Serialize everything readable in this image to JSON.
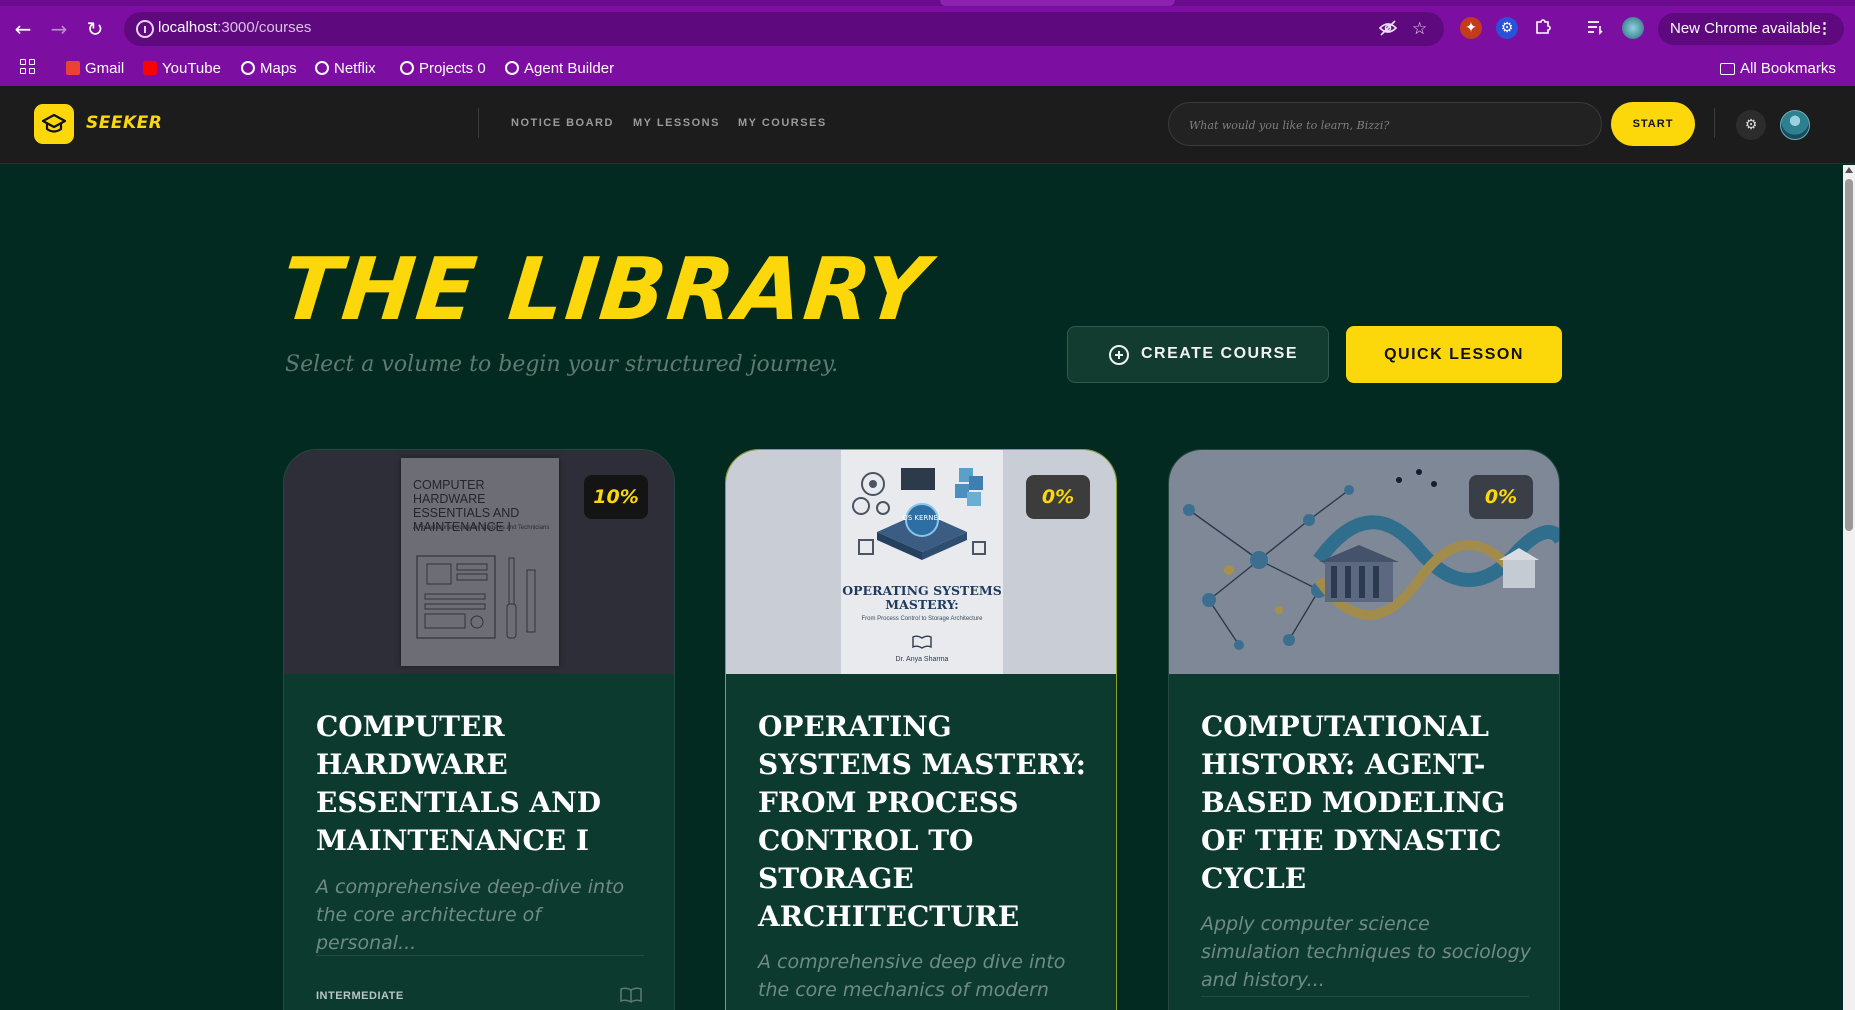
{
  "browser": {
    "url_host": "localhost",
    "url_path": ":3000/courses",
    "update_label": "New Chrome available",
    "bookmarks": [
      "Gmail",
      "YouTube",
      "Maps",
      "Netflix",
      "Projects 0",
      "Agent Builder"
    ],
    "all_bookmarks": "All Bookmarks"
  },
  "header": {
    "brand": "SEEKER",
    "nav": [
      "NOTICE BOARD",
      "MY LESSONS",
      "MY COURSES"
    ],
    "search_placeholder": "What would you like to learn, Bizzi?",
    "start_label": "START"
  },
  "main": {
    "title": "THE LIBRARY",
    "subtitle": "Select a volume to begin your structured journey.",
    "create_label": "CREATE COURSE",
    "quick_label": "QUICK LESSON"
  },
  "courses": [
    {
      "progress": "10%",
      "cover_title": "COMPUTER HARDWARE ESSENTIALS AND MAINTENANCE I",
      "cover_subtitle": "A Foundational Guide for Students and Technicians",
      "title": "COMPUTER HARDWARE ESSENTIALS AND MAINTENANCE I",
      "description": "A comprehensive deep-dive into the core architecture of personal...",
      "level": "INTERMEDIATE"
    },
    {
      "progress": "0%",
      "cover_title": "OPERATING SYSTEMS MASTERY:",
      "cover_subtitle": "From Process Control to Storage Architecture",
      "cover_author": "Dr. Anya Sharma",
      "cover_kernel": "OS KERNEL",
      "title": "OPERATING SYSTEMS MASTERY: FROM PROCESS CONTROL TO STORAGE ARCHITECTURE",
      "description": "A comprehensive deep dive into the core mechanics of modern operatin..."
    },
    {
      "progress": "0%",
      "title": "COMPUTATIONAL HISTORY: AGENT-BASED MODELING OF THE DYNASTIC CYCLE",
      "description": "Apply computer science simulation techniques to sociology and history..."
    }
  ],
  "colors": {
    "accent": "#fcd80b",
    "browser_frame": "#7c0ea1",
    "page_bg": "#032a20",
    "card_bg": "#0d3a2e"
  }
}
